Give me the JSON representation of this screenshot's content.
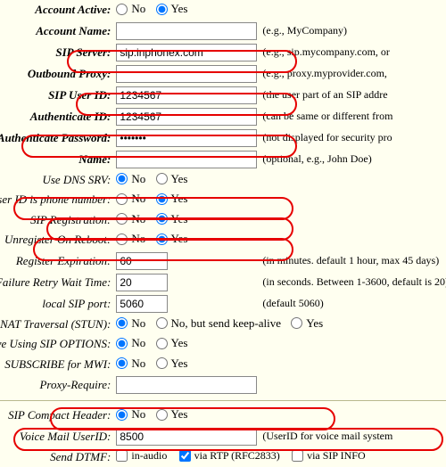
{
  "labels": {
    "account_active": "Account Active:",
    "account_name": "Account Name:",
    "sip_server": "SIP Server:",
    "outbound_proxy": "Outbound Proxy:",
    "sip_user_id": "SIP User ID:",
    "auth_id": "Authenticate ID:",
    "auth_pw": "Authenticate Password:",
    "name": "Name:",
    "use_dns_srv": "Use DNS SRV:",
    "uid_is_phone": "User ID is phone number:",
    "sip_reg": "SIP Registration:",
    "unreg_reboot": "Unregister On Reboot:",
    "reg_exp": "Register Expiration:",
    "retry_wait": "tion Failure Retry Wait Time:",
    "local_sip_port": "local SIP port:",
    "nat_trav": "NAT Traversal (STUN):",
    "keepalive": "-Alive Using SIP OPTIONS:",
    "sub_mwi": "SUBSCRIBE for MWI:",
    "proxy_require": "Proxy-Require:",
    "compact_hdr": "SIP Compact Header:",
    "vm_userid": "Voice Mail UserID:",
    "send_dtmf": "Send DTMF:"
  },
  "values": {
    "account_name": "",
    "sip_server": "sip.inphonex.com",
    "outbound_proxy": "",
    "sip_user_id": "1234567",
    "auth_id": "1234567",
    "auth_pw": "•••••••",
    "name": "",
    "reg_exp": "60",
    "retry_wait": "20",
    "local_sip_port": "5060",
    "proxy_require": "",
    "vm_userid": "8500"
  },
  "hints": {
    "account_name": "(e.g., MyCompany)",
    "sip_server": "(e.g., sip.mycompany.com, or",
    "outbound_proxy": "(e.g., proxy.myprovider.com,",
    "sip_user_id": "(the user part of an SIP addre",
    "auth_id": "(can be same or different from",
    "auth_pw": "(not displayed for security pro",
    "name": "(optional, e.g., John Doe)",
    "reg_exp": "(in minutes. default 1 hour, max 45 days)",
    "retry_wait": "(in seconds. Between 1-3600, default is 20)",
    "local_sip_port": "(default 5060)",
    "vm_userid": "(UserID for voice mail system"
  },
  "radios": {
    "no": "No",
    "yes": "Yes",
    "no_keepalive": "No, but send keep-alive"
  },
  "dtmf": {
    "in_audio": "in-audio",
    "via_rtp": "via RTP (RFC2833)",
    "via_sip_info": "via SIP INFO"
  },
  "states": {
    "account_active": "yes",
    "use_dns_srv": "no",
    "uid_is_phone": "yes",
    "sip_reg": "yes",
    "unreg_reboot": "yes",
    "nat_trav": "no",
    "keepalive": "no",
    "sub_mwi": "no",
    "compact_hdr": "no",
    "dtmf_in_audio": false,
    "dtmf_via_rtp": true,
    "dtmf_via_sip_info": false
  }
}
